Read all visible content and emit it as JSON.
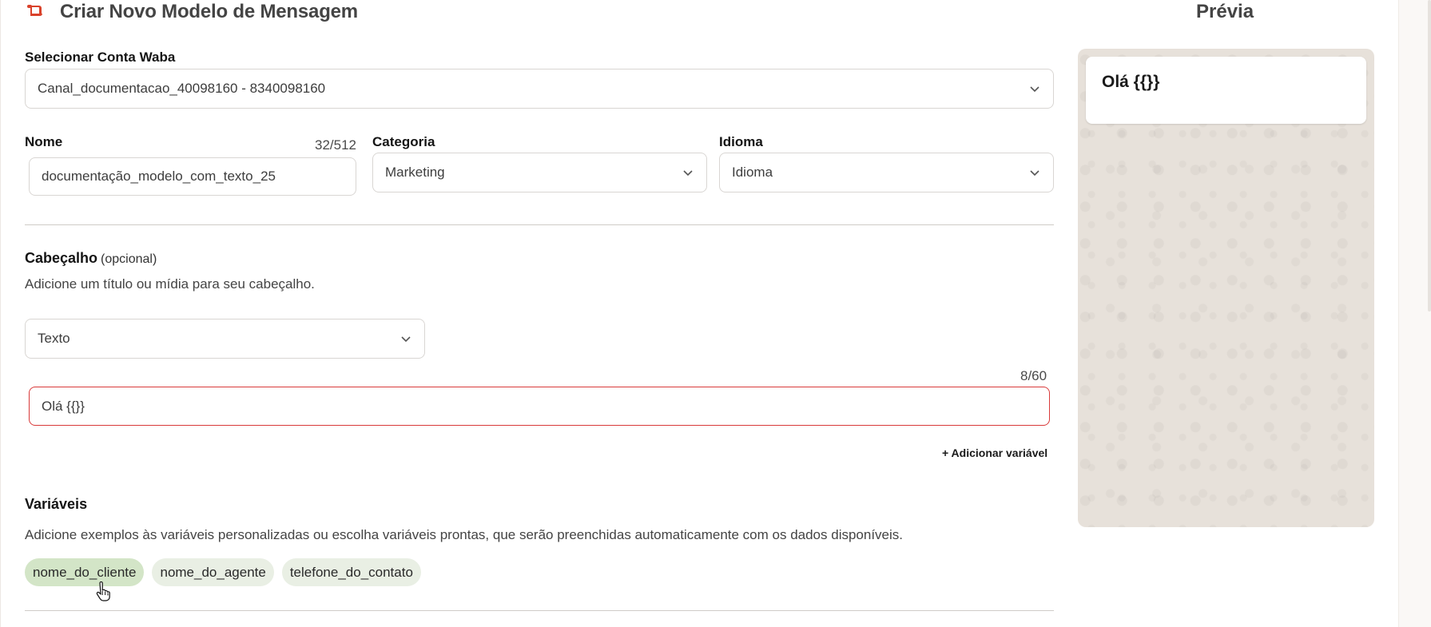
{
  "header": {
    "title": "Criar Novo Modelo de Mensagem",
    "title_icon": "scroll-icon",
    "accent_color": "#d9422b"
  },
  "preview": {
    "title": "Prévia",
    "bubble_text": "Olá {{}}"
  },
  "waba": {
    "label": "Selecionar Conta Waba",
    "value": "Canal_documentacao_40098160 - 8340098160"
  },
  "name": {
    "label": "Nome",
    "counter": "32/512",
    "value": "documentação_modelo_com_texto_25"
  },
  "category": {
    "label": "Categoria",
    "value": "Marketing"
  },
  "language": {
    "label": "Idioma",
    "value": "Idioma"
  },
  "header_section": {
    "title": "Cabeçalho",
    "optional": "(opcional)",
    "description": "Adicione um título ou mídia para seu cabeçalho.",
    "type_value": "Texto",
    "counter": "8/60",
    "text_value": "Olá {{}}",
    "add_variable": "+ Adicionar variável"
  },
  "variables": {
    "title": "Variáveis",
    "description": "Adicione exemplos às variáveis personalizadas ou escolha variáveis prontas, que serão preenchidas automaticamente com os dados disponíveis.",
    "chips": [
      "nome_do_cliente",
      "nome_do_agente",
      "telefone_do_contato"
    ]
  },
  "colors": {
    "error_border": "#d93a3a",
    "chip_bg": "#e9efe4",
    "chip_hover_bg": "#d3e5c7",
    "preview_bg": "#e7e1da"
  }
}
